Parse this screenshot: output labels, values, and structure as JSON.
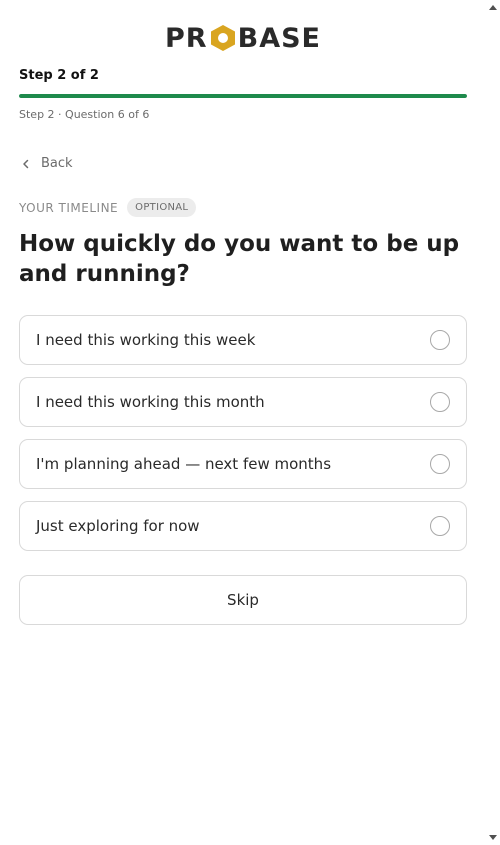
{
  "brand": {
    "logo_text_left": "PR",
    "logo_text_right": "BASE",
    "hex_color": "#d9a520",
    "text_color": "#2a2a2a"
  },
  "progress": {
    "step_title": "Step 2 of 2",
    "fill_percent": 100,
    "fill_color": "#1e8a4c",
    "sub_label": "Step 2 · Question 6 of 6"
  },
  "nav": {
    "back_label": "Back",
    "back_icon": "chevron-left-icon"
  },
  "question": {
    "eyebrow": "YOUR TIMELINE",
    "badge": "OPTIONAL",
    "title": "How quickly do you want to be up and running?"
  },
  "options": [
    {
      "label": "I need this working this week",
      "selected": false
    },
    {
      "label": "I need this working this month",
      "selected": false
    },
    {
      "label": "I'm planning ahead — next few months",
      "selected": false
    },
    {
      "label": "Just exploring for now",
      "selected": false
    }
  ],
  "actions": {
    "skip_label": "Skip"
  }
}
